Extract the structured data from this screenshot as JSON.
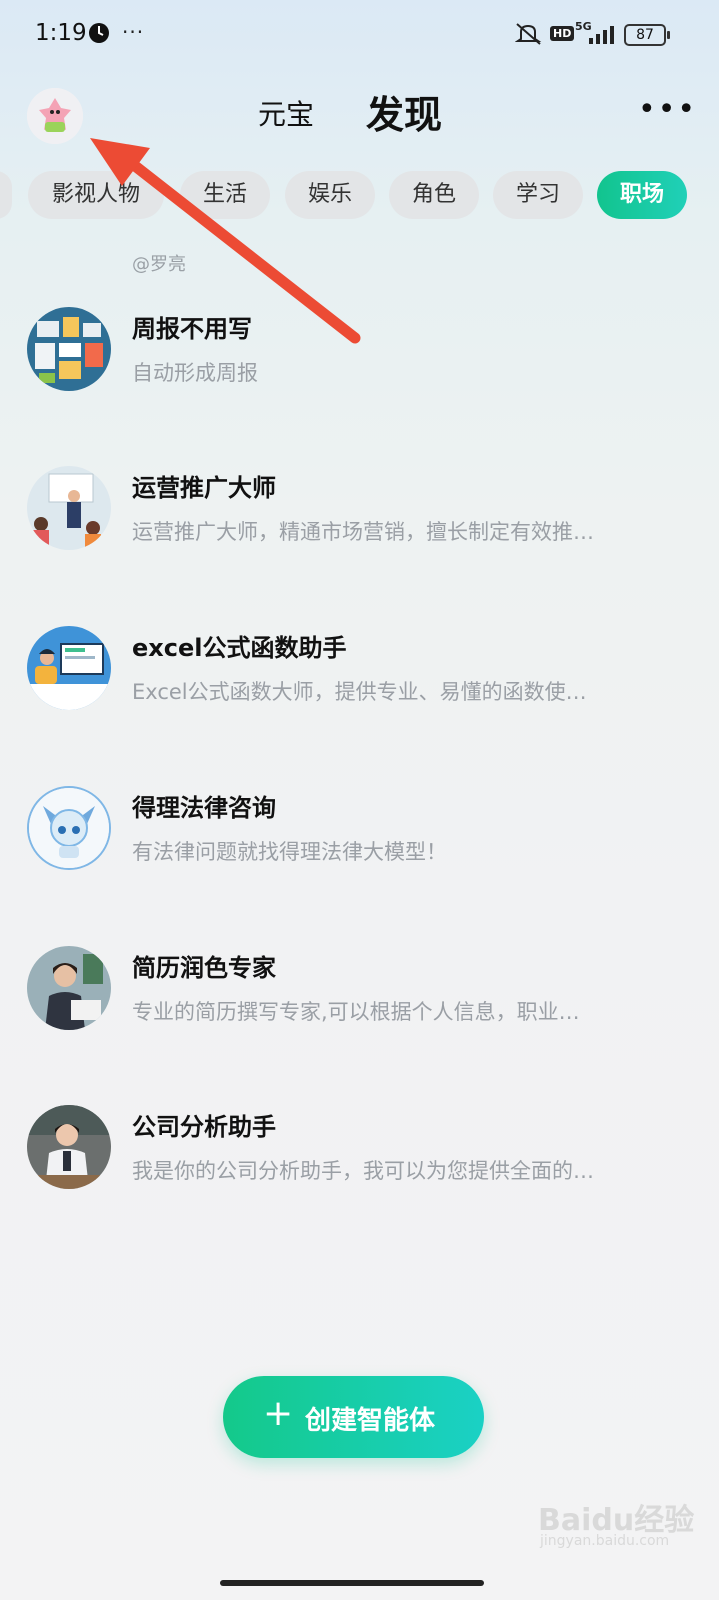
{
  "status_bar": {
    "time": "1:19",
    "dots": "···",
    "network": "5G",
    "hd": "HD",
    "battery": "87"
  },
  "header": {
    "brand": "元宝",
    "title": "发现",
    "more": "•••"
  },
  "tabs": [
    {
      "label": "影视人物",
      "active": false
    },
    {
      "label": "生活",
      "active": false
    },
    {
      "label": "娱乐",
      "active": false
    },
    {
      "label": "角色",
      "active": false
    },
    {
      "label": "学习",
      "active": false
    },
    {
      "label": "职场",
      "active": true
    }
  ],
  "author": "@罗亮",
  "items": [
    {
      "title": "周报不用写",
      "desc": "自动形成周报"
    },
    {
      "title": "运营推广大师",
      "desc": "运营推广大师，精通市场营销，擅长制定有效推…"
    },
    {
      "title": "excel公式函数助手",
      "desc": "Excel公式函数大师，提供专业、易懂的函数使…"
    },
    {
      "title": "得理法律咨询",
      "desc": "有法律问题就找得理法律大模型！"
    },
    {
      "title": "简历润色专家",
      "desc": "专业的简历撰写专家,可以根据个人信息，职业…"
    },
    {
      "title": "公司分析助手",
      "desc": "我是你的公司分析助手，我可以为您提供全面的…"
    }
  ],
  "create_button": {
    "plus": "+",
    "label": "创建智能体"
  },
  "watermark": {
    "text": "Baidu经验",
    "sub": "jingyan.baidu.com"
  },
  "colors": {
    "accent": "#14c98a",
    "annotation_arrow": "#ec4b34"
  }
}
